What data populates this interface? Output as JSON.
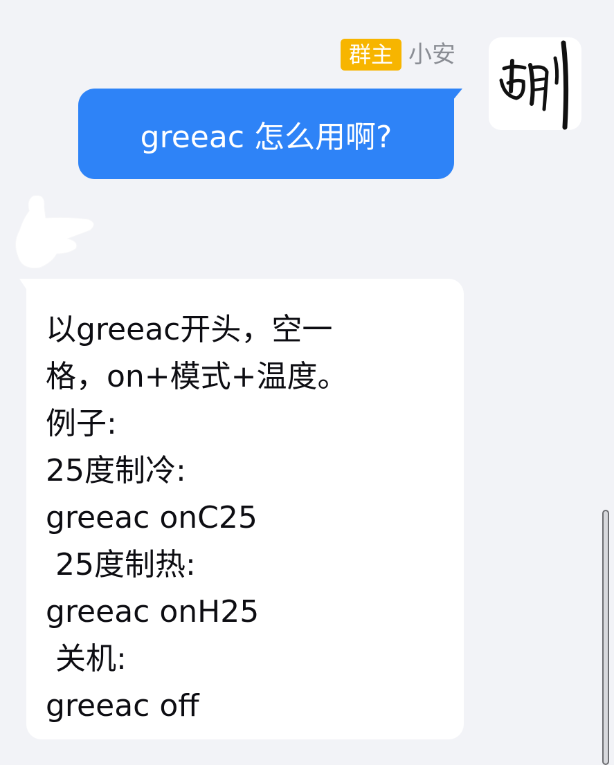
{
  "chat": {
    "sender": {
      "badge": "群主",
      "name": "小安",
      "avatar_icon": "calligraphy-avatar-icon"
    },
    "outgoing_message": "greeac 怎么用啊?",
    "sticker_icon": "hand-sticker-icon",
    "reply_lines": [
      "以greeac开头，空一",
      "格，on+模式+温度。",
      "例子:",
      "25度制冷:",
      "greeac onC25",
      " 25度制热:",
      "greeac onH25",
      " 关机:",
      "greeac off"
    ],
    "colors": {
      "background": "#f2f3f7",
      "outgoing_bubble": "#2e83f7",
      "badge": "#f7b500",
      "incoming_bubble": "#ffffff"
    }
  }
}
